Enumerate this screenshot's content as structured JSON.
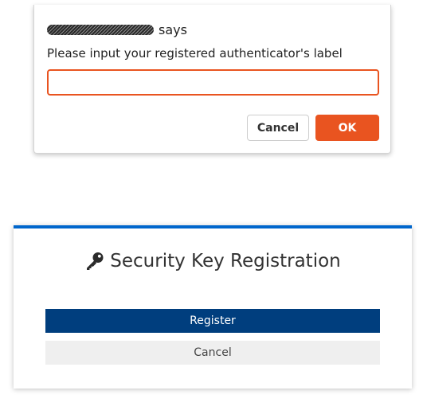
{
  "prompt": {
    "says_label": "says",
    "message": "Please input your registered authenticator's label",
    "input_value": "",
    "cancel_label": "Cancel",
    "ok_label": "OK",
    "accent_color": "#e95420"
  },
  "panel": {
    "title": "Security Key Registration",
    "title_icon": "key-icon",
    "register_label": "Register",
    "cancel_label": "Cancel",
    "accent_color": "#0066cc",
    "register_color": "#003e7e"
  }
}
